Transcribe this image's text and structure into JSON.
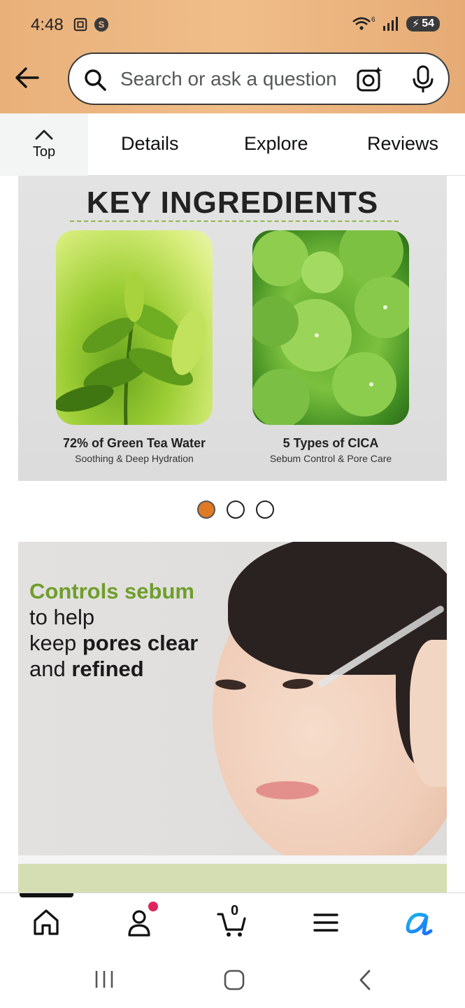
{
  "status_bar": {
    "time": "4:48",
    "signal_label": "6",
    "battery": "54"
  },
  "header": {
    "search_placeholder": "Search or ask a question"
  },
  "tabs": {
    "top_label": "Top",
    "items": [
      "Details",
      "Explore",
      "Reviews"
    ]
  },
  "ingredients_image": {
    "title": "KEY INGREDIENTS",
    "items": [
      {
        "name": "72% of Green Tea Water",
        "desc": "Soothing & Deep Hydration"
      },
      {
        "name": "5 Types of CICA",
        "desc": "Sebum Control & Pore Care"
      }
    ]
  },
  "carousel": {
    "total": 3,
    "active_index": 0,
    "active_color": "#e07a24"
  },
  "promo_image": {
    "line1": "Controls sebum",
    "line2": "to help",
    "line3_a": "keep ",
    "line3_b": "pores clear",
    "line4_a": "and ",
    "line4_b": "refined",
    "accent_color": "#6f9e2b"
  },
  "bottom_nav": {
    "cart_count": "0",
    "icons": [
      "home-icon",
      "account-icon",
      "cart-icon",
      "menu-icon",
      "rufus-icon"
    ]
  },
  "colors": {
    "header_bg": "#eeb985",
    "notification_dot": "#e0245e",
    "rufus_blue": "#1a98ff"
  }
}
